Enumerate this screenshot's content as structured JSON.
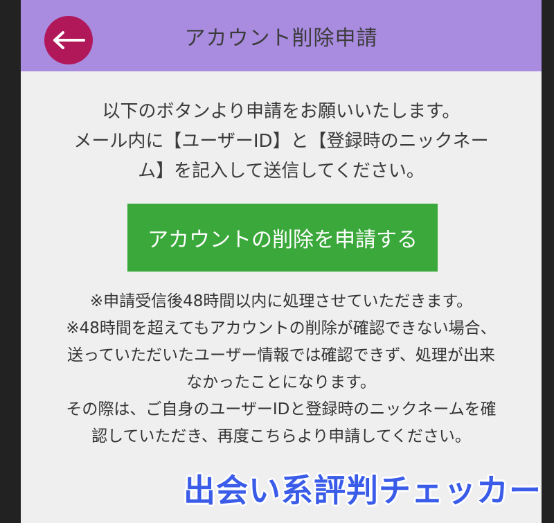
{
  "header": {
    "title": "アカウント削除申請",
    "back_icon": "arrow-left-icon",
    "back_color": "#b0185a",
    "bg_color": "#a98be0"
  },
  "intro_lines": [
    "以下のボタンより申請をお願いいたします。",
    "メール内に【ユーザーID】と【登録時のニックネー",
    "ム】を記入して送信してください。"
  ],
  "action_button": {
    "label": "アカウントの削除を申請する",
    "color": "#3aa83a"
  },
  "notes_lines": [
    "※申請受信後48時間以内に処理させていただきます。",
    "※48時間を超えてもアカウントの削除が確認できない場合、",
    "送っていただいたユーザー情報では確認できず、処理が出来",
    "なかったことになります。",
    "その際は、ご自身のユーザーIDと登録時のニックネームを確",
    "認していただき、再度こちらより申請してください。"
  ],
  "watermark": "出会い系評判チェッカー"
}
